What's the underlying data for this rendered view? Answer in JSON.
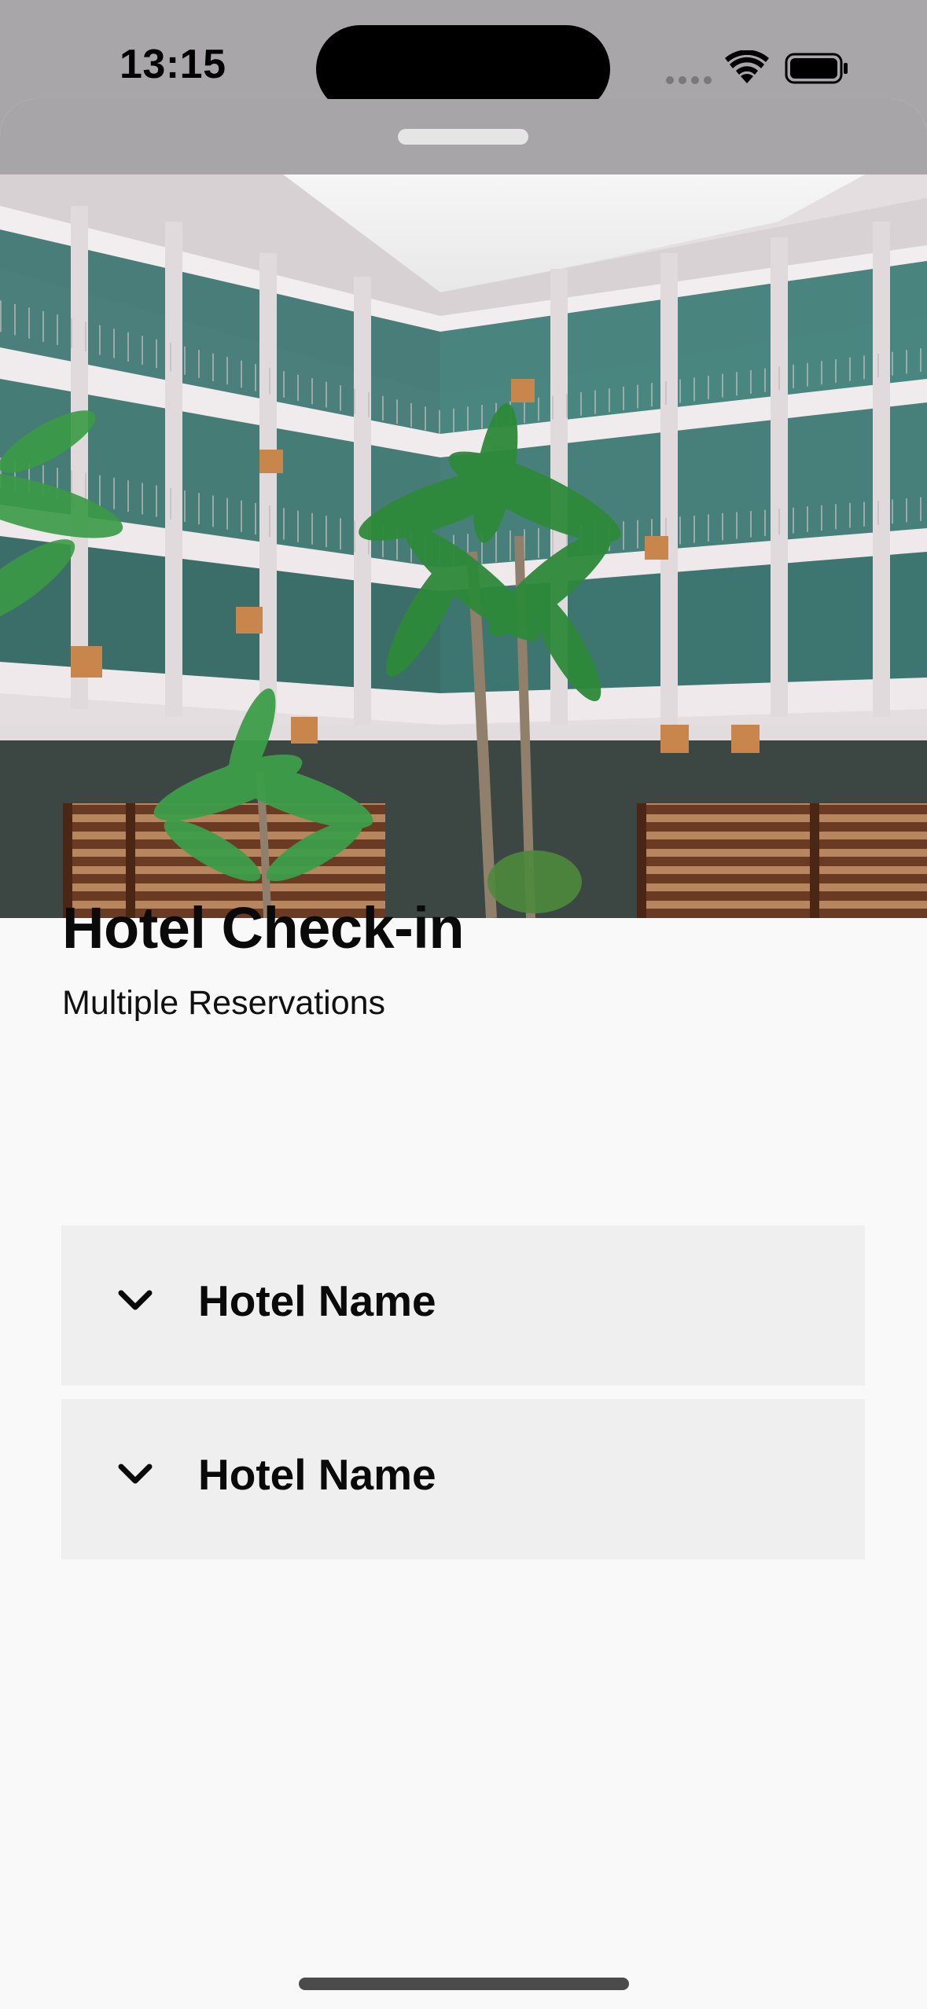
{
  "status_bar": {
    "time": "13:15"
  },
  "hero_image": {
    "description": "hotel courtyard with palm trees"
  },
  "header": {
    "title": "Hotel Check-in",
    "subtitle": "Multiple Reservations"
  },
  "reservations": [
    {
      "label": "Hotel Name",
      "icon": "chevron-down-icon",
      "expanded": false
    },
    {
      "label": "Hotel Name",
      "icon": "chevron-down-icon",
      "expanded": false
    }
  ],
  "colors": {
    "sheet_background": "#f9f9f9",
    "accordion_background": "#efefef",
    "dimmed_background": "#a8a6a8",
    "text": "#0a0a0a"
  }
}
